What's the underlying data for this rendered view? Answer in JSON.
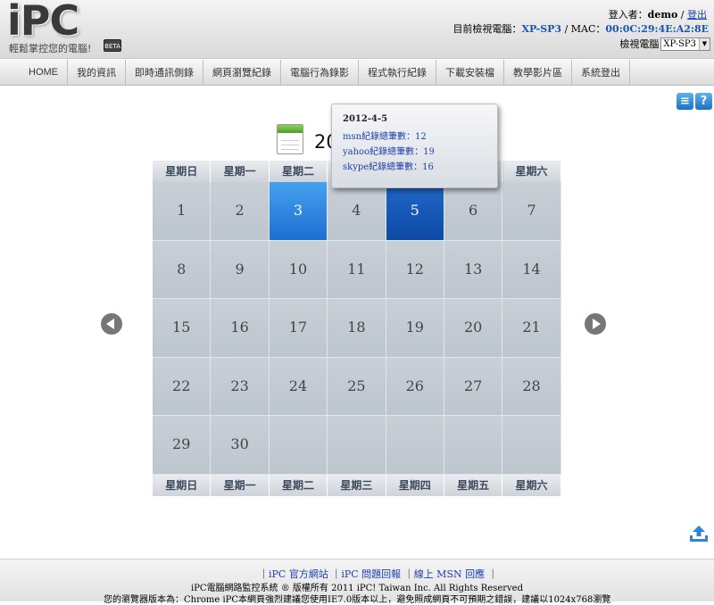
{
  "logo": {
    "text": "iPC",
    "subtitle": "輕鬆掌控您的電腦!",
    "badge": "BETA"
  },
  "user": {
    "prefix": "登入者：",
    "name": "demo",
    "separator": " / ",
    "logout": "登出"
  },
  "monitor": {
    "label": "目前檢視電腦：",
    "pc": "XP-SP3",
    "mac_label": " / MAC：",
    "mac": "00:0C:29:4E:A2:8E"
  },
  "selector": {
    "label": "檢視電腦",
    "value": "XP-SP3"
  },
  "nav": [
    "HOME",
    "我的資訊",
    "即時通訊側錄",
    "網頁瀏覽紀錄",
    "電腦行為錄影",
    "程式執行紀錄",
    "下載安裝檔",
    "教學影片區",
    "系統登出"
  ],
  "calendar": {
    "title": "2012年 4月",
    "weekdays": [
      "星期日",
      "星期一",
      "星期二",
      "星期三",
      "星期四",
      "星期五",
      "星期六"
    ],
    "days": [
      "1",
      "2",
      "3",
      "4",
      "5",
      "6",
      "7",
      "8",
      "9",
      "10",
      "11",
      "12",
      "13",
      "14",
      "15",
      "16",
      "17",
      "18",
      "19",
      "20",
      "21",
      "22",
      "23",
      "24",
      "25",
      "26",
      "27",
      "28",
      "29",
      "30",
      "",
      "",
      "",
      "",
      ""
    ],
    "selected_light": "3",
    "selected_dark": "5"
  },
  "tooltip": {
    "date": "2012-4-5",
    "msn": "msn紀錄總筆數：12",
    "yahoo": "yahoo紀錄總筆數：19",
    "skype": "skype紀錄總筆數：16"
  },
  "footer": {
    "links": [
      "iPC 官方網站",
      "iPC 問題回報",
      "線上 MSN 回應"
    ],
    "copyright": "iPC電腦網路監控系統 ® 版權所有 2011 iPC! Taiwan Inc. All Rights Reserved",
    "browser_note": "您的瀏覽器版本為：Chrome iPC本網頁強烈建議您使用IE7.0版本以上，避免照成網頁不可預期之錯誤，建議以1024x768瀏覽"
  }
}
